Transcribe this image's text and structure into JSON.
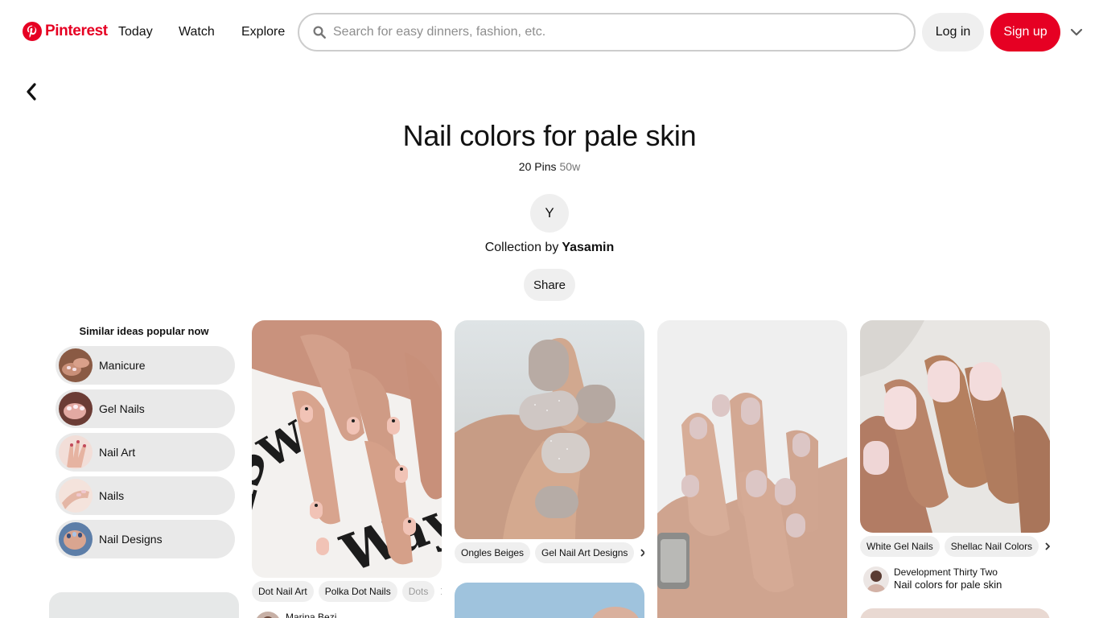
{
  "brand": {
    "name": "Pinterest",
    "color": "#e60023"
  },
  "nav": {
    "today": "Today",
    "watch": "Watch",
    "explore": "Explore"
  },
  "search": {
    "placeholder": "Search for easy dinners, fashion, etc.",
    "value": "",
    "icon": "search-icon"
  },
  "auth": {
    "login_label": "Log in",
    "signup_label": "Sign up",
    "menu_icon": "chevron-down-icon"
  },
  "back": {
    "icon": "chevron-left-icon"
  },
  "board": {
    "title": "Nail colors for pale skin",
    "pin_count": "20 Pins",
    "age": "50w",
    "avatar_initial": "Y",
    "collection_by": "Collection by",
    "owner": "Yasamin",
    "share_label": "Share"
  },
  "similar": {
    "title": "Similar ideas popular now",
    "items": [
      {
        "label": "Manicure"
      },
      {
        "label": "Gel Nails"
      },
      {
        "label": "Nail Art"
      },
      {
        "label": "Nails"
      },
      {
        "label": "Nail Designs"
      }
    ]
  },
  "pins": [
    {
      "chips": [
        "Dot Nail Art",
        "Polka Dot Nails",
        "Dots"
      ],
      "attribution_name": "Marina Bezi"
    },
    {
      "chips": [
        "Ongles Beiges",
        "Gel Nail Art Designs"
      ]
    },
    {},
    {
      "chips": [
        "White Gel Nails",
        "Shellac Nail Colors"
      ],
      "attribution_name": "Development Thirty Two",
      "attribution_board": "Nail colors for pale skin"
    }
  ]
}
